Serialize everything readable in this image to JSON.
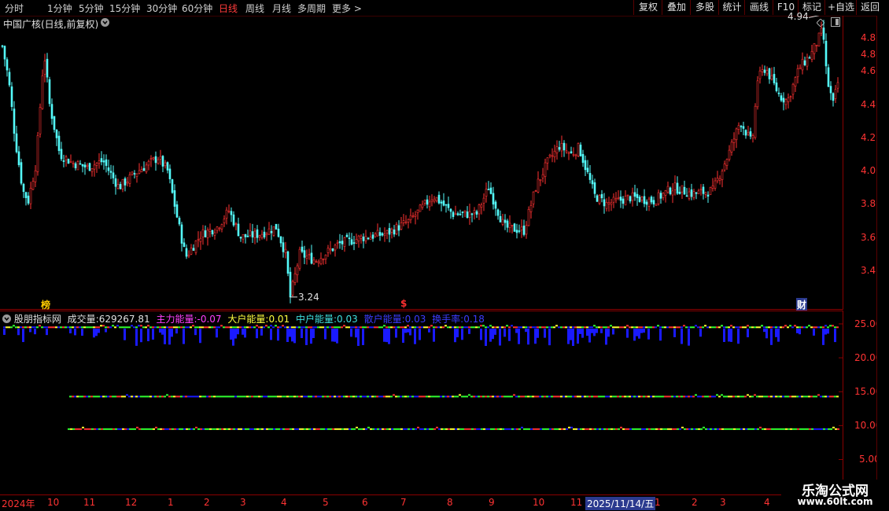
{
  "toolbar": {
    "periods": [
      "分时",
      "1分钟",
      "5分钟",
      "15分钟",
      "30分钟",
      "60分钟",
      "日线",
      "周线",
      "月线",
      "多周期",
      "更多 >"
    ],
    "active_period": "日线",
    "right_buttons": [
      "复权",
      "叠加",
      "多股",
      "统计",
      "画线",
      "F10",
      "标记",
      "+自选",
      "返回"
    ]
  },
  "main": {
    "title": "中国广核(日线,前复权)",
    "axis": [
      "4.80",
      "4.60",
      "4.40",
      "4.20",
      "4.00",
      "3.80",
      "3.60",
      "3.40"
    ],
    "high_label": "4.94",
    "low_label": "3.24",
    "markers": [
      "榜",
      "$",
      "财"
    ]
  },
  "sub": {
    "name": "股朋指标网",
    "vol_label": "成交量:",
    "vol_value": "629267.81",
    "zl_label": "主力能量:",
    "zl_value": "-0.07",
    "dh_label": "大户能量:",
    "dh_value": "0.01",
    "zh_label": "中户能量:",
    "zh_value": "0.03",
    "sh_label": "散户能量:",
    "sh_value": "0.03",
    "hs_label": "换手率:",
    "hs_value": "0.18",
    "axis": [
      "25.00",
      "20.00",
      "15.00",
      "10.00",
      "5.00"
    ]
  },
  "timeline": {
    "ticks": [
      "2024年",
      "10",
      "11",
      "12",
      "1",
      "2",
      "3",
      "4",
      "5",
      "6",
      "7",
      "8",
      "9",
      "10",
      "11",
      "2025/11/14/五",
      "1",
      "2",
      "3",
      "4"
    ]
  },
  "watermark": {
    "name": "乐淘公式网",
    "url": "www.60lt.com"
  },
  "chart_data": {
    "type": "candlestick",
    "title": "中国广核(日线,前复权)",
    "y_ticks": [
      3.4,
      3.6,
      3.8,
      4.0,
      4.2,
      4.4,
      4.6,
      4.8
    ],
    "ylim": [
      3.18,
      5.02
    ],
    "price_path": [
      [
        0,
        4.8
      ],
      [
        10,
        4.55
      ],
      [
        18,
        4.2
      ],
      [
        28,
        3.88
      ],
      [
        35,
        3.82
      ],
      [
        45,
        4.05
      ],
      [
        55,
        4.72
      ],
      [
        62,
        4.4
      ],
      [
        75,
        4.1
      ],
      [
        90,
        4.05
      ],
      [
        110,
        4.02
      ],
      [
        130,
        4.06
      ],
      [
        150,
        3.9
      ],
      [
        175,
        4.0
      ],
      [
        200,
        4.08
      ],
      [
        212,
        4.0
      ],
      [
        225,
        3.7
      ],
      [
        235,
        3.48
      ],
      [
        255,
        3.62
      ],
      [
        275,
        3.66
      ],
      [
        290,
        3.76
      ],
      [
        305,
        3.6
      ],
      [
        330,
        3.62
      ],
      [
        350,
        3.66
      ],
      [
        362,
        3.5
      ],
      [
        368,
        3.24
      ],
      [
        380,
        3.5
      ],
      [
        400,
        3.46
      ],
      [
        430,
        3.56
      ],
      [
        460,
        3.6
      ],
      [
        490,
        3.62
      ],
      [
        520,
        3.7
      ],
      [
        550,
        3.85
      ],
      [
        575,
        3.74
      ],
      [
        605,
        3.74
      ],
      [
        620,
        3.9
      ],
      [
        640,
        3.66
      ],
      [
        665,
        3.64
      ],
      [
        680,
        3.9
      ],
      [
        695,
        4.05
      ],
      [
        710,
        4.15
      ],
      [
        725,
        4.1
      ],
      [
        735,
        4.14
      ],
      [
        755,
        3.85
      ],
      [
        770,
        3.8
      ],
      [
        800,
        3.84
      ],
      [
        830,
        3.82
      ],
      [
        855,
        3.9
      ],
      [
        880,
        3.86
      ],
      [
        905,
        3.88
      ],
      [
        925,
        4.1
      ],
      [
        940,
        4.3
      ],
      [
        955,
        4.16
      ],
      [
        962,
        4.55
      ],
      [
        972,
        4.62
      ],
      [
        990,
        4.45
      ],
      [
        1000,
        4.42
      ],
      [
        1015,
        4.62
      ],
      [
        1030,
        4.7
      ],
      [
        1045,
        4.85
      ],
      [
        1050,
        4.55
      ],
      [
        1058,
        4.4
      ],
      [
        1065,
        4.55
      ]
    ],
    "high_annotation": 4.94,
    "low_annotation": 3.24,
    "indicator": {
      "name": "股朋指标网",
      "y_ticks": [
        5,
        10,
        15,
        20,
        25
      ],
      "ylim": [
        2,
        27
      ],
      "series": [
        {
          "name": "主力能量",
          "value": -0.07
        },
        {
          "name": "大户能量",
          "value": 0.01
        },
        {
          "name": "中户能量",
          "value": 0.03
        },
        {
          "name": "散户能量",
          "value": 0.03
        },
        {
          "name": "换手率",
          "value": 0.18
        }
      ],
      "volume_value": 629267.81
    }
  }
}
